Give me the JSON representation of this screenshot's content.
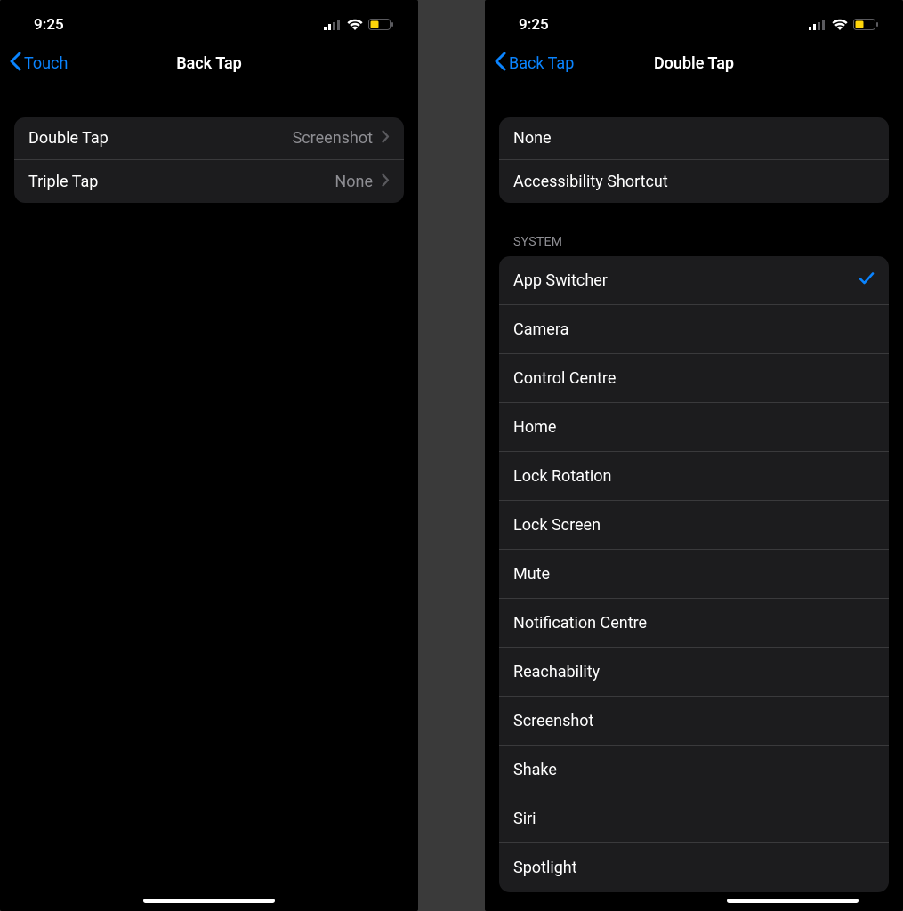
{
  "status": {
    "time": "9:25"
  },
  "left": {
    "back_label": "Touch",
    "title": "Back Tap",
    "rows": [
      {
        "label": "Double Tap",
        "value": "Screenshot"
      },
      {
        "label": "Triple Tap",
        "value": "None"
      }
    ]
  },
  "right": {
    "back_label": "Back Tap",
    "title": "Double Tap",
    "first_group": [
      {
        "label": "None",
        "checked": false
      },
      {
        "label": "Accessibility Shortcut",
        "checked": false
      }
    ],
    "system_header": "SYSTEM",
    "system_items": [
      {
        "label": "App Switcher",
        "checked": true
      },
      {
        "label": "Camera",
        "checked": false
      },
      {
        "label": "Control Centre",
        "checked": false
      },
      {
        "label": "Home",
        "checked": false
      },
      {
        "label": "Lock Rotation",
        "checked": false
      },
      {
        "label": "Lock Screen",
        "checked": false
      },
      {
        "label": "Mute",
        "checked": false
      },
      {
        "label": "Notification Centre",
        "checked": false
      },
      {
        "label": "Reachability",
        "checked": false
      },
      {
        "label": "Screenshot",
        "checked": false
      },
      {
        "label": "Shake",
        "checked": false
      },
      {
        "label": "Siri",
        "checked": false
      },
      {
        "label": "Spotlight",
        "checked": false
      }
    ]
  }
}
